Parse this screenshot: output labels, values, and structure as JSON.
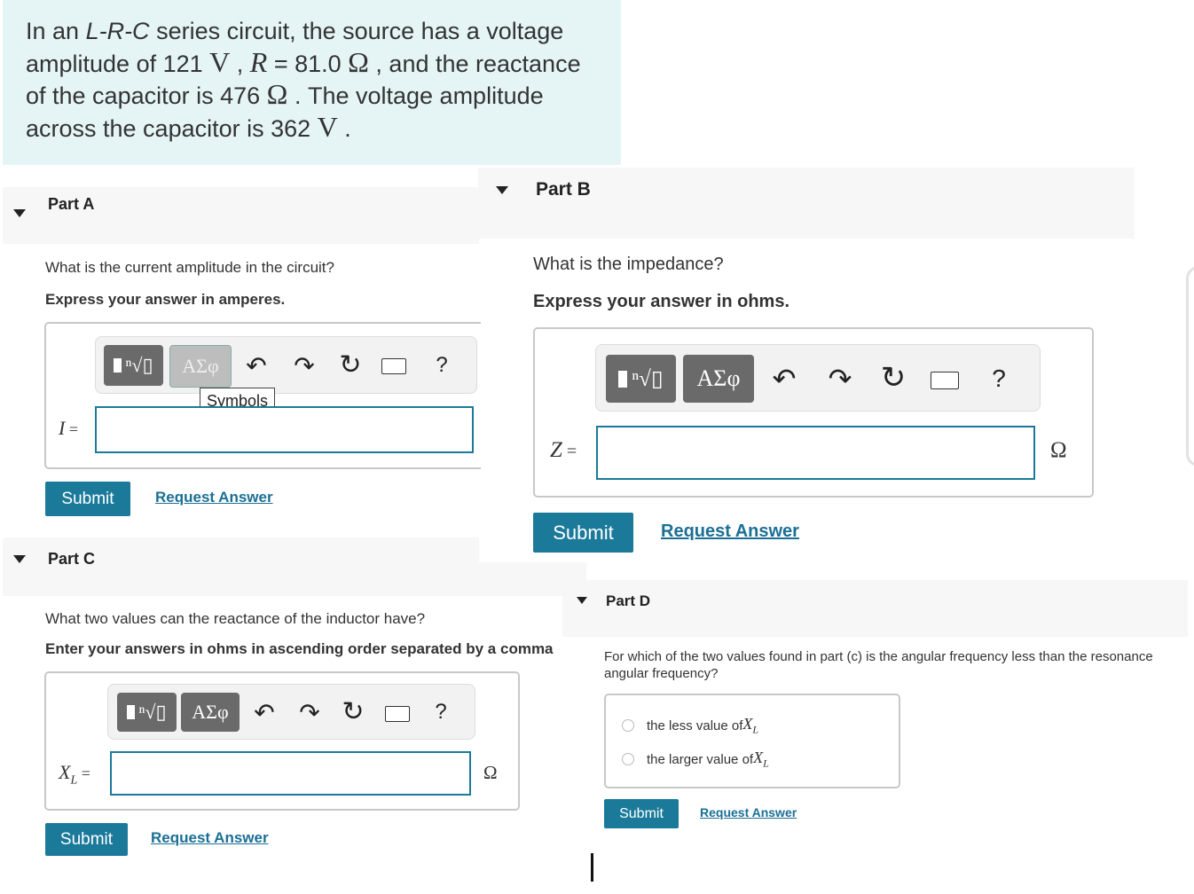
{
  "intro": {
    "p1": "In an ",
    "circuit": "L-R-C",
    "p2": " series circuit, the source has a voltage amplitude of 121 ",
    "u1": "V",
    "p3": " , ",
    "r_sym": "R",
    "p4": " = 81.0 ",
    "u2": "Ω",
    "p5": " , and the reactance of the capacitor is 476 ",
    "u3": "Ω",
    "p6": " . The voltage amplitude across the capacitor is 362 ",
    "u4": "V",
    "p7": " ."
  },
  "toolbar": {
    "alpha_label": "ΑΣφ",
    "help_label": "?",
    "tooltip": "Symbols"
  },
  "partA": {
    "title": "Part A",
    "question": "What is the current amplitude in the circuit?",
    "instruction": "Express your answer in amperes.",
    "var": "I",
    "eq": " =",
    "value": "",
    "submit": "Submit",
    "request": "Request Answer"
  },
  "partB": {
    "title": "Part B",
    "question": "What is the impedance?",
    "instruction": "Express your answer in ohms.",
    "var": "Z",
    "eq": " =",
    "unit": "Ω",
    "value": "",
    "submit": "Submit",
    "request": "Request Answer"
  },
  "partC": {
    "title": "Part C",
    "question": "What two values can the reactance of the inductor have?",
    "instruction": "Enter your answers in ohms in ascending order separated by a comma",
    "var": "X",
    "sub": "L",
    "eq": " =",
    "unit": "Ω",
    "value": "",
    "submit": "Submit",
    "request": "Request Answer"
  },
  "partD": {
    "title": "Part D",
    "question": "For which of the two values found in part (c) is the angular frequency less than the resonance angular frequency?",
    "options": [
      {
        "label": "the less value of ",
        "var": "X",
        "sub": "L"
      },
      {
        "label": "the larger value of ",
        "var": "X",
        "sub": "L"
      }
    ],
    "submit": "Submit",
    "request": "Request Answer"
  }
}
